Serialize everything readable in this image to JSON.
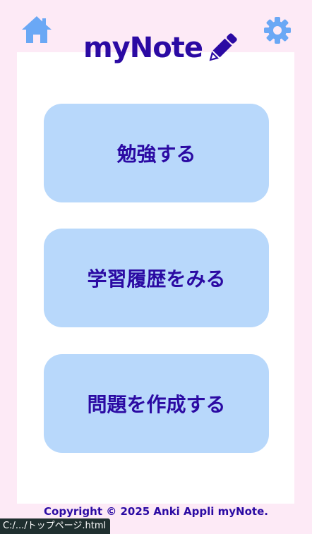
{
  "header": {
    "home_icon": "home-icon",
    "settings_icon": "gear-icon",
    "logo_text": "myNote",
    "logo_icon": "pencil-icon"
  },
  "menu": {
    "study_label": "勉強する",
    "history_label": "学習履歴をみる",
    "create_label": "問題を作成する"
  },
  "footer": {
    "copyright": "Copyright © 2025 Anki Appli myNote."
  },
  "status_bar": {
    "url": "C:/.../トップページ.html"
  },
  "colors": {
    "background": "#fdeaf6",
    "panel": "#ffffff",
    "button": "#b8d8fb",
    "text": "#2b0aa3",
    "icon": "#6aa8f5"
  }
}
